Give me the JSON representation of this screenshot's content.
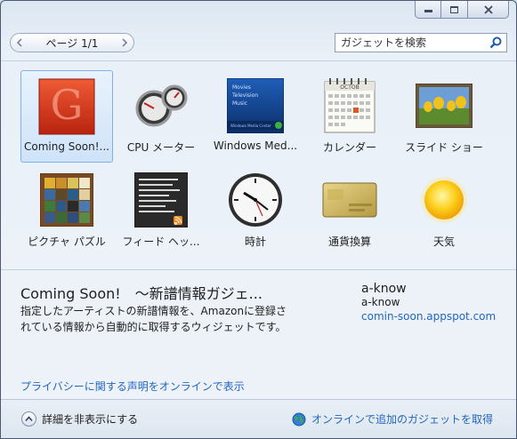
{
  "window": {
    "caption_buttons": [
      "minimize",
      "maximize",
      "close"
    ]
  },
  "toolbar": {
    "pager_label": "ページ 1/1",
    "search_placeholder": "ガジェットを検索"
  },
  "gadgets": [
    {
      "label": "Coming Soon!...",
      "icon": "coming-soon-icon",
      "selected": true
    },
    {
      "label": "CPU メーター",
      "icon": "cpu-meter-icon"
    },
    {
      "label": "Windows Med...",
      "icon": "media-center-icon",
      "thumb_text": [
        "Movies",
        "Television",
        "Music",
        "Windows Media Center"
      ]
    },
    {
      "label": "カレンダー",
      "icon": "calendar-icon",
      "thumb_text": "OCTOB"
    },
    {
      "label": "スライド ショー",
      "icon": "slideshow-icon"
    },
    {
      "label": "ピクチャ パズル",
      "icon": "picture-puzzle-icon"
    },
    {
      "label": "フィード ヘッ...",
      "icon": "feed-headlines-icon"
    },
    {
      "label": "時計",
      "icon": "clock-icon"
    },
    {
      "label": "通貨換算",
      "icon": "currency-icon"
    },
    {
      "label": "天気",
      "icon": "weather-icon"
    }
  ],
  "details": {
    "title": "Coming Soon!　～新譜情報ガジェ...",
    "description": "指定したアーティストの新譜情報を、Amazonに登録されている情報から自動的に取得するウィジェットです。",
    "author_name": "a-know",
    "author_name_2": "a-know",
    "author_link": "comin-soon.appspot.com",
    "privacy_link": "プライバシーに関する声明をオンラインで表示"
  },
  "footer": {
    "toggle_label": "詳細を非表示にする",
    "online_label": "オンラインで追加のガジェットを取得"
  },
  "colors": {
    "link": "#2266c0",
    "selection": "#cfe3f9",
    "accent_red": "#d8371e"
  }
}
